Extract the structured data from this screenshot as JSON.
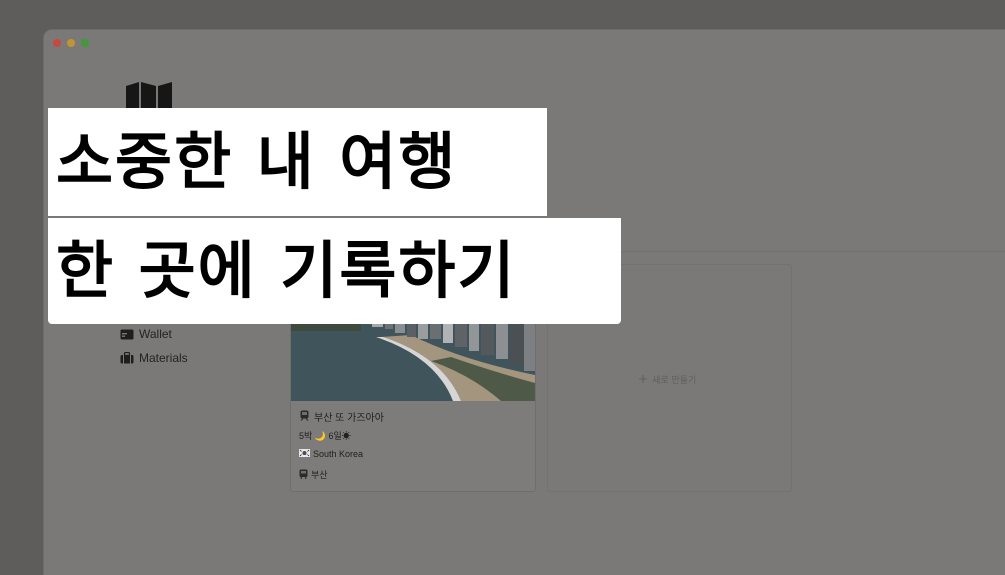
{
  "caption": {
    "line1": "소중한 내 여행",
    "line2": "한 곳에 기록하기"
  },
  "sidebar": {
    "items": [
      {
        "label": "Wallet",
        "icon": "wallet-icon"
      },
      {
        "label": "Materials",
        "icon": "luggage-icon"
      }
    ]
  },
  "gallery": {
    "card": {
      "title": "부산 또 가즈아아",
      "title_icon": "train-icon",
      "duration": "5박 🌙 6일☀",
      "country": "South Korea",
      "country_icon": "korea-flag-icon",
      "city": "부산",
      "city_icon": "bus-icon"
    },
    "new_label": "새로 만들기"
  },
  "colors": {
    "overlay_bg": "#5e5d5b",
    "caption_bg": "#ffffff",
    "caption_text": "#000000"
  }
}
